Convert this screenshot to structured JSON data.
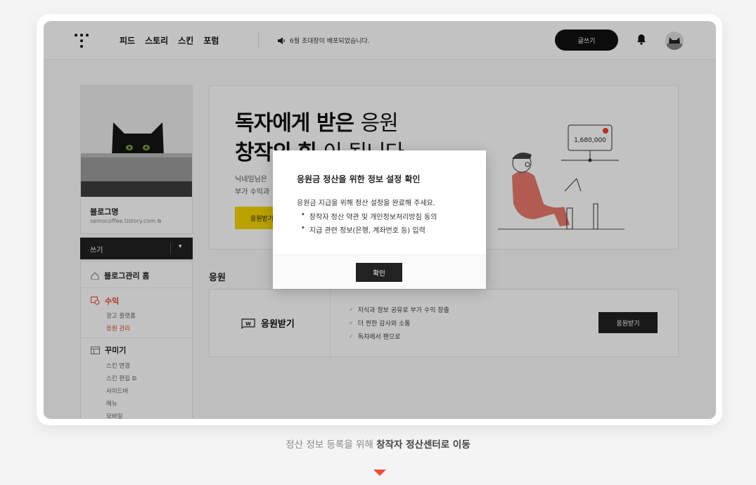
{
  "header": {
    "nav": [
      "피드",
      "스토리",
      "스킨",
      "포럼"
    ],
    "notice": "6월 초대장이 배포되었습니다.",
    "write_button": "글쓰기"
  },
  "sidebar": {
    "blog_name": "블로그명",
    "blog_url": "semocoffee.tistory.com",
    "write_label": "쓰기",
    "menu": {
      "home": "블로그관리 홈",
      "revenue": "수익",
      "ad_platform": "광고 플랫폼",
      "support_manage": "응원 관리",
      "decorate": "꾸미기",
      "skin_change": "스킨 변경",
      "skin_edit": "스킨 편집",
      "sidebar": "사이드바",
      "menu_item": "메뉴",
      "mobile": "모바일"
    }
  },
  "banner": {
    "line1_bold": "독자에게 받은",
    "line1_light": "응원",
    "line2_bold": "창작의 힘",
    "line2_light": "이 됩니다",
    "desc1": "닉네임님은",
    "desc2": "부가 수익과",
    "button": "응원받기",
    "amount": "1,680,000"
  },
  "support": {
    "section_title": "응원",
    "title": "응원받기",
    "checks": [
      "지식과 정보 공유로 부가 수익 창출",
      "더 찐한 감사와 소통",
      "독자에서 팬으로"
    ],
    "button": "응원받기"
  },
  "modal": {
    "title": "응원금 정산을 위한 정보 설정 확인",
    "body": "응원금 지급을 위해 정산 설정을 완료해 주세요.",
    "bullets": [
      "창작자 정산 약관 및 개인정보처리방침 동의",
      "지급 관련 정보(은행, 계좌번호 등) 입력"
    ],
    "ok": "확인"
  },
  "caption": {
    "prefix": "정산 정보 등록을 위해",
    "bold": "창작자 정산센터로 이동"
  }
}
